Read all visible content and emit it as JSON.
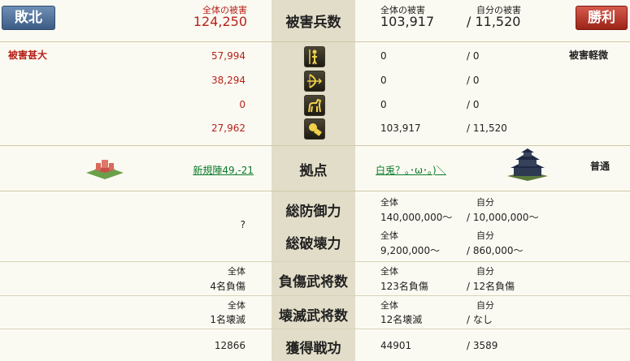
{
  "header": {
    "lose_badge": "敗北",
    "win_badge": "勝利",
    "left_total_label": "全体の被害",
    "left_total_value": "124,250",
    "center_title": "被害兵数",
    "right_total_label": "全体の被害",
    "right_total_value": "103,917",
    "right_self_label": "自分の被害",
    "right_self_value": "/ 11,520"
  },
  "damage": {
    "left_status": "被害甚大",
    "right_status": "被害軽微",
    "rows": [
      {
        "icon": "spearman-icon",
        "left": "57,994",
        "total": "0",
        "self": "/ 0"
      },
      {
        "icon": "archer-icon",
        "left": "38,294",
        "total": "0",
        "self": "/ 0"
      },
      {
        "icon": "cavalry-icon",
        "left": "0",
        "total": "0",
        "self": "/ 0"
      },
      {
        "icon": "siege-icon",
        "left": "27,962",
        "total": "103,917",
        "self": "/ 11,520"
      }
    ]
  },
  "base": {
    "center_label": "拠点",
    "left_link": "新規陣49,-21",
    "right_link": "白兎？｡･ω･｡)＼",
    "right_type": "普通"
  },
  "defense": {
    "label_defense": "総防御力",
    "label_destruction": "総破壊力",
    "left_value": "?",
    "total_label": "全体",
    "self_label": "自分",
    "defense_total": "140,000,000～",
    "defense_self": "/ 10,000,000～",
    "destruct_total": "9,200,000～",
    "destruct_self": "/ 860,000～"
  },
  "injured": {
    "center_label": "負傷武将数",
    "left_label": "全体",
    "left_value": "4名負傷",
    "total_label": "全体",
    "total_value": "123名負傷",
    "self_label": "自分",
    "self_value": "/ 12名負傷"
  },
  "destroyed": {
    "center_label": "壊滅武将数",
    "left_label": "全体",
    "left_value": "1名壊滅",
    "total_label": "全体",
    "total_value": "12名壊滅",
    "self_label": "自分",
    "self_value": "/ なし"
  },
  "merit": {
    "center_label": "獲得戦功",
    "left_value": "12866",
    "total_value": "44901",
    "self_value": "/ 3589"
  },
  "colors": {
    "lose": "#3c5c85",
    "win": "#9c2417",
    "accent_red": "#b5221a",
    "link_green": "#0a7a2a"
  }
}
